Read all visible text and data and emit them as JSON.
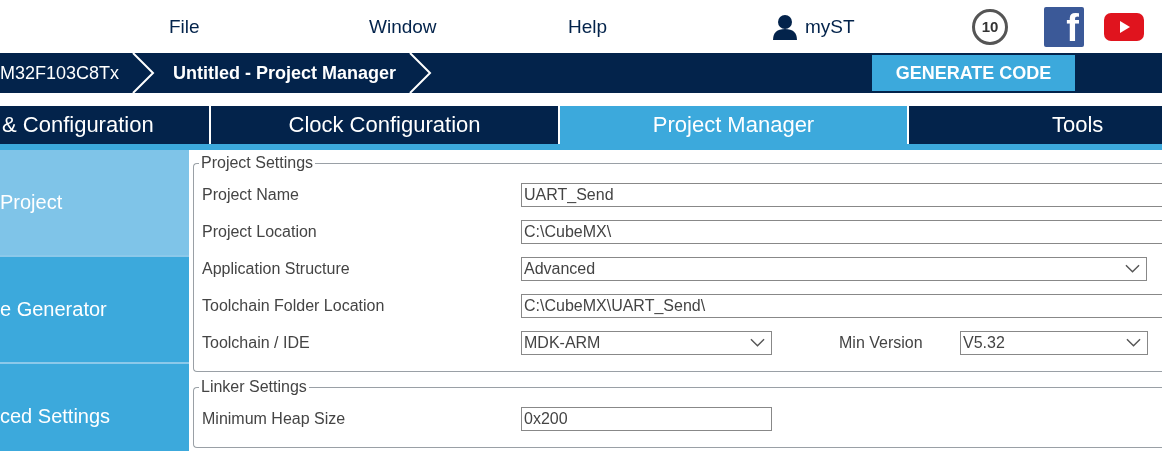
{
  "menu": [
    {
      "label": "File"
    },
    {
      "label": "Window"
    },
    {
      "label": "Help"
    }
  ],
  "user": {
    "label": "myST"
  },
  "badge": {
    "label": "10"
  },
  "facebook": {
    "label": "f"
  },
  "breadcrumbs": [
    {
      "label": "M32F103C8Tx"
    },
    {
      "label": "Untitled - Project Manager",
      "selected": true
    }
  ],
  "generate_button": {
    "label": "GENERATE CODE"
  },
  "tabs": [
    {
      "label": "& Configuration",
      "selected": false
    },
    {
      "label": "Clock Configuration",
      "selected": false
    },
    {
      "label": "Project Manager",
      "selected": true
    },
    {
      "label": "Tools",
      "selected": false
    }
  ],
  "sidebar": {
    "items": [
      {
        "label": "Project",
        "selected": true
      },
      {
        "label": "e Generator",
        "selected": false
      },
      {
        "label": "ced Settings",
        "selected": false
      }
    ]
  },
  "sections": [
    {
      "title": "Project Settings",
      "rows": [
        {
          "label": "Project Name",
          "kind": "text",
          "value": "UART_Send"
        },
        {
          "label": "Project Location",
          "kind": "text",
          "value": "C:\\CubeMX\\"
        },
        {
          "label": "Application Structure",
          "kind": "select",
          "value": "Advanced"
        },
        {
          "label": "Toolchain Folder Location",
          "kind": "text",
          "value": "C:\\CubeMX\\UART_Send\\"
        },
        {
          "label": "Toolchain / IDE",
          "kind": "short_select",
          "value": "MDK-ARM",
          "secondary": {
            "label": "Min Version",
            "value": "V5.32"
          }
        }
      ]
    },
    {
      "title": "Linker Settings",
      "rows": [
        {
          "label": "Minimum Heap Size",
          "kind": "short_text",
          "value": "0x200"
        }
      ]
    }
  ]
}
